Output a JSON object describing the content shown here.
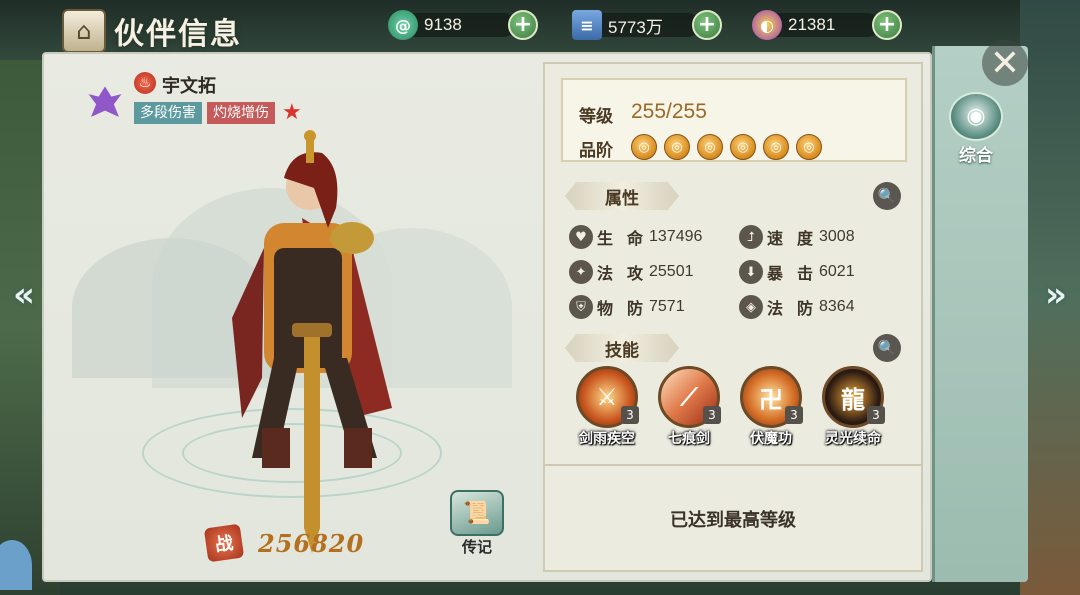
{
  "header": {
    "title": "伙伴信息",
    "title_icon": "house-icon"
  },
  "currencies": [
    {
      "name": "jade",
      "icon": "jade-coin-icon",
      "value": "9138",
      "color": "#3aa37f"
    },
    {
      "name": "silver-book",
      "icon": "book-icon",
      "value": "5773万",
      "color": "#4a7fc0"
    },
    {
      "name": "spirit-crystal",
      "icon": "crystal-icon",
      "value": "21381",
      "color": "#b35bd8"
    }
  ],
  "character": {
    "element": "fire",
    "name": "宇文拓",
    "tags": [
      "多段伤害",
      "灼烧增伤"
    ],
    "power_badge": "战",
    "power": "256820"
  },
  "biography_label": "传记",
  "side_tab": {
    "label": "综合",
    "icon": "swirl-icon"
  },
  "info": {
    "level_label": "等级",
    "level_value": "255/255",
    "grade_label": "品阶",
    "grade_count": 6,
    "attributes_title": "属性",
    "stats": [
      {
        "name": "生命",
        "value": "137496",
        "icon": "heart-icon"
      },
      {
        "name": "速度",
        "value": "3008",
        "icon": "boot-icon"
      },
      {
        "name": "法攻",
        "value": "25501",
        "icon": "wand-icon"
      },
      {
        "name": "暴击",
        "value": "6021",
        "icon": "crit-icon"
      },
      {
        "name": "物防",
        "value": "7571",
        "icon": "shield-icon"
      },
      {
        "name": "法防",
        "value": "8364",
        "icon": "magic-shield-icon"
      }
    ],
    "skills_title": "技能",
    "skills": [
      {
        "name": "剑雨疾空",
        "level": "3",
        "color": "#c9561e"
      },
      {
        "name": "七痕剑",
        "level": "3",
        "color": "#e07a4a"
      },
      {
        "name": "伏魔功",
        "level": "3",
        "color": "#d8732a"
      },
      {
        "name": "灵光续命",
        "level": "3",
        "color": "#2a1a12"
      }
    ],
    "max_message": "已达到最高等级"
  }
}
